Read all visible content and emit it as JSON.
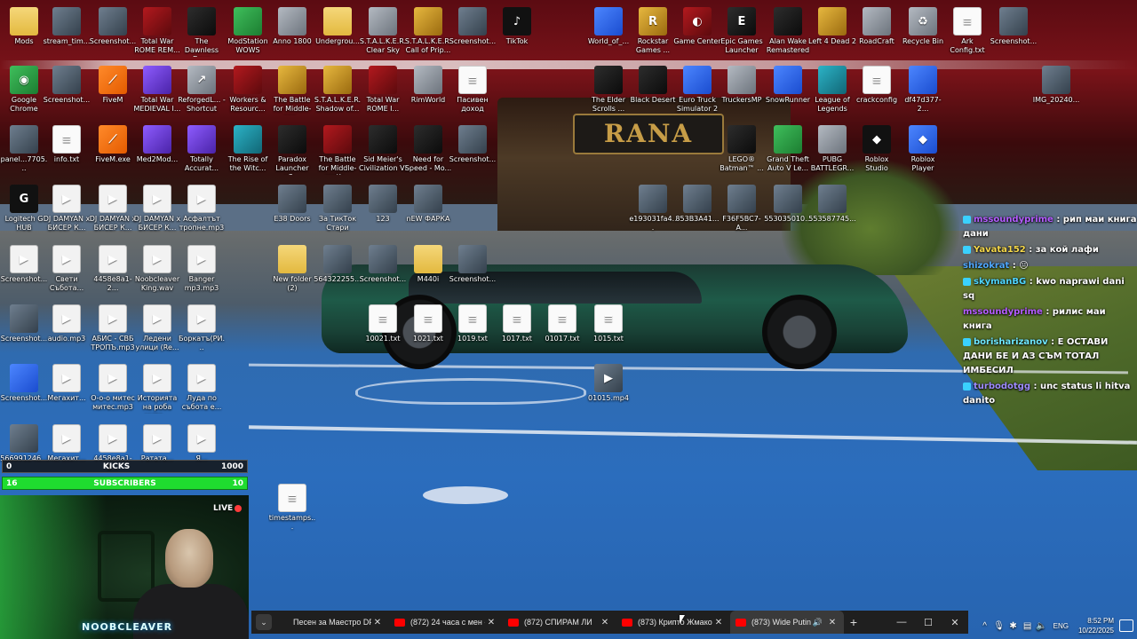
{
  "desktop_icons": [
    {
      "label": "Mods",
      "icon": "folder-icon",
      "kind": "folder"
    },
    {
      "label": "stream_tim...",
      "icon": "image-file-icon",
      "kind": "img"
    },
    {
      "label": "Screenshot...",
      "icon": "image-file-icon",
      "kind": "img"
    },
    {
      "label": "Total War ROME REM...",
      "icon": "game-icon",
      "kind": "red"
    },
    {
      "label": "The Dawnless Days Officia...",
      "icon": "game-icon",
      "kind": "dark"
    },
    {
      "label": "ModStation WOWS",
      "icon": "game-icon",
      "kind": "green"
    },
    {
      "label": "Anno 1800",
      "icon": "game-icon",
      "kind": "gray"
    },
    {
      "label": "Undergrou...",
      "icon": "folder-icon",
      "kind": "folder"
    },
    {
      "label": "S.T.A.L.K.E.R. Clear Sky",
      "icon": "game-icon",
      "kind": "gray"
    },
    {
      "label": "S.T.A.L.K.E.R. Call of Prip...",
      "icon": "game-icon",
      "kind": "gold"
    },
    {
      "label": "Screenshot...",
      "icon": "image-file-icon",
      "kind": "img"
    },
    {
      "label": "TikTok",
      "icon": "tiktok-icon",
      "kind": "black"
    },
    {
      "label": "World_of_...",
      "icon": "game-icon",
      "kind": "blue"
    },
    {
      "label": "Rockstar Games ...",
      "icon": "rockstar-icon",
      "kind": "gold"
    },
    {
      "label": "Game Center",
      "icon": "game-center-icon",
      "kind": "red"
    },
    {
      "label": "Epic Games Launcher",
      "icon": "epic-games-icon",
      "kind": "dark"
    },
    {
      "label": "Alan Wake Remastered",
      "icon": "game-icon",
      "kind": "dark"
    },
    {
      "label": "Left 4 Dead 2",
      "icon": "game-icon",
      "kind": "gold"
    },
    {
      "label": "RoadCraft",
      "icon": "game-icon",
      "kind": "gray"
    },
    {
      "label": "Recycle Bin",
      "icon": "recycle-bin-icon",
      "kind": "gray"
    },
    {
      "label": "Ark Config.txt",
      "icon": "text-file-icon",
      "kind": "doc"
    },
    {
      "label": "Screenshot...",
      "icon": "image-file-icon",
      "kind": "img"
    },
    {
      "label": "Google Chrome",
      "icon": "chrome-icon",
      "kind": "green"
    },
    {
      "label": "Screenshot...",
      "icon": "image-file-icon",
      "kind": "img"
    },
    {
      "label": "FiveM",
      "icon": "fivem-icon",
      "kind": "orange"
    },
    {
      "label": "Total War MEDIEVAL I...",
      "icon": "game-icon",
      "kind": "purple"
    },
    {
      "label": "ReforgedL... - Shortcut",
      "icon": "shortcut-icon",
      "kind": "gray"
    },
    {
      "label": "Workers & Resourc...",
      "icon": "game-icon",
      "kind": "red"
    },
    {
      "label": "The Battle for Middle-ear...",
      "icon": "game-icon",
      "kind": "gold"
    },
    {
      "label": "S.T.A.L.K.E.R. Shadow of...",
      "icon": "game-icon",
      "kind": "gold"
    },
    {
      "label": "Total War ROME I...",
      "icon": "game-icon",
      "kind": "red"
    },
    {
      "label": "RimWorld",
      "icon": "game-icon",
      "kind": "gray"
    },
    {
      "label": "Пасивен доход",
      "icon": "text-file-icon",
      "kind": "doc"
    },
    {
      "label": "The Elder Scrolls ...",
      "icon": "game-icon",
      "kind": "dark"
    },
    {
      "label": "Black Desert",
      "icon": "game-icon",
      "kind": "dark"
    },
    {
      "label": "Euro Truck Simulator 2",
      "icon": "game-icon",
      "kind": "blue"
    },
    {
      "label": "TruckersMP",
      "icon": "game-icon",
      "kind": "gray"
    },
    {
      "label": "SnowRunner",
      "icon": "game-icon",
      "kind": "blue"
    },
    {
      "label": "League of Legends",
      "icon": "game-icon",
      "kind": "teal"
    },
    {
      "label": "crackconfig",
      "icon": "text-file-icon",
      "kind": "doc"
    },
    {
      "label": "df47d377-2...",
      "icon": "image-file-icon",
      "kind": "blue"
    },
    {
      "label": "IMG_20240...",
      "icon": "image-file-icon",
      "kind": "img"
    },
    {
      "label": "panel...7705...",
      "icon": "image-file-icon",
      "kind": "img"
    },
    {
      "label": "info.txt",
      "icon": "text-file-icon",
      "kind": "doc"
    },
    {
      "label": "FiveM.exe",
      "icon": "fivem-icon",
      "kind": "orange"
    },
    {
      "label": "Med2Mod...",
      "icon": "game-icon",
      "kind": "purple"
    },
    {
      "label": "Totally Accurat...",
      "icon": "game-icon",
      "kind": "purple"
    },
    {
      "label": "The Rise of the Witc...",
      "icon": "game-icon",
      "kind": "teal"
    },
    {
      "label": "Paradox Launcher v2...",
      "icon": "game-icon",
      "kind": "dark"
    },
    {
      "label": "The Battle for Middle-earth...",
      "icon": "game-icon",
      "kind": "red"
    },
    {
      "label": "Sid Meier's Civilization VI",
      "icon": "game-icon",
      "kind": "dark"
    },
    {
      "label": "Need for Speed - Mo...",
      "icon": "game-icon",
      "kind": "dark"
    },
    {
      "label": "Screenshot...",
      "icon": "image-file-icon",
      "kind": "img"
    },
    {
      "label": "LEGO® Batman™ ...",
      "icon": "game-icon",
      "kind": "dark"
    },
    {
      "label": "Grand Theft Auto V Le...",
      "icon": "game-icon",
      "kind": "green"
    },
    {
      "label": "PUBG BATTLEGR...",
      "icon": "game-icon",
      "kind": "gray"
    },
    {
      "label": "Roblox Studio",
      "icon": "roblox-icon",
      "kind": "black"
    },
    {
      "label": "Roblox Player",
      "icon": "roblox-icon",
      "kind": "blue"
    },
    {
      "label": "Logitech G HUB",
      "icon": "logitech-icon",
      "kind": "black"
    },
    {
      "label": "DJ DAMYAN x БИСЕР К...",
      "icon": "media-file-icon",
      "kind": "media"
    },
    {
      "label": "DJ DAMYAN x БИСЕР К...",
      "icon": "media-file-icon",
      "kind": "media"
    },
    {
      "label": "DJ DAMYAN x БИСЕР К...",
      "icon": "media-file-icon",
      "kind": "media"
    },
    {
      "label": "Асфалтът тропне.mp3",
      "icon": "media-file-icon",
      "kind": "media"
    },
    {
      "label": "E38 Doors",
      "icon": "image-file-icon",
      "kind": "img"
    },
    {
      "label": "За ТикТок Стари",
      "icon": "folder-icon",
      "kind": "img"
    },
    {
      "label": "123",
      "icon": "image-file-icon",
      "kind": "img"
    },
    {
      "label": "nEW ФАРКА",
      "icon": "image-file-icon",
      "kind": "img"
    },
    {
      "label": "e193031fa4...",
      "icon": "image-file-icon",
      "kind": "img"
    },
    {
      "label": "853B3A41...",
      "icon": "image-file-icon",
      "kind": "img"
    },
    {
      "label": "F36F5BC7-A...",
      "icon": "image-file-icon",
      "kind": "img"
    },
    {
      "label": "553035010...",
      "icon": "image-file-icon",
      "kind": "img"
    },
    {
      "label": "553587745...",
      "icon": "image-file-icon",
      "kind": "img"
    },
    {
      "label": "Screenshot...",
      "icon": "media-file-icon",
      "kind": "media"
    },
    {
      "label": "Свети Събота...",
      "icon": "media-file-icon",
      "kind": "media"
    },
    {
      "label": "4458e8a1-2...",
      "icon": "media-file-icon",
      "kind": "media"
    },
    {
      "label": "Noobcleaver King.wav",
      "icon": "media-file-icon",
      "kind": "media"
    },
    {
      "label": "Banger mp3.mp3",
      "icon": "media-file-icon",
      "kind": "media"
    },
    {
      "label": "New folder (2)",
      "icon": "folder-icon",
      "kind": "folder"
    },
    {
      "label": "564322255...",
      "icon": "image-file-icon",
      "kind": "img"
    },
    {
      "label": "Screenshot...",
      "icon": "image-file-icon",
      "kind": "img"
    },
    {
      "label": "M440i",
      "icon": "folder-icon",
      "kind": "folder"
    },
    {
      "label": "Screenshot...",
      "icon": "image-file-icon",
      "kind": "img"
    },
    {
      "label": "Screenshot...",
      "icon": "image-file-icon",
      "kind": "img"
    },
    {
      "label": "audio.mp3",
      "icon": "media-file-icon",
      "kind": "media"
    },
    {
      "label": "АБИС - СВБ ТРОПЪ.mp3",
      "icon": "media-file-icon",
      "kind": "media"
    },
    {
      "label": "Ледени улици (Re...",
      "icon": "media-file-icon",
      "kind": "media"
    },
    {
      "label": "Боркатъ(РИ...",
      "icon": "media-file-icon",
      "kind": "media"
    },
    {
      "label": "10021.txt",
      "icon": "text-file-icon",
      "kind": "doc"
    },
    {
      "label": "1021.txt",
      "icon": "text-file-icon",
      "kind": "doc"
    },
    {
      "label": "1019.txt",
      "icon": "text-file-icon",
      "kind": "doc"
    },
    {
      "label": "1017.txt",
      "icon": "text-file-icon",
      "kind": "doc"
    },
    {
      "label": "01017.txt",
      "icon": "text-file-icon",
      "kind": "doc"
    },
    {
      "label": "1015.txt",
      "icon": "text-file-icon",
      "kind": "doc"
    },
    {
      "label": "Screenshot...",
      "icon": "image-file-icon",
      "kind": "blue"
    },
    {
      "label": "Мегахит...",
      "icon": "media-file-icon",
      "kind": "media"
    },
    {
      "label": "О-о-о митес митес.mp3",
      "icon": "media-file-icon",
      "kind": "media"
    },
    {
      "label": "Историята на роба мита...",
      "icon": "media-file-icon",
      "kind": "media"
    },
    {
      "label": "Луда по събота е...",
      "icon": "media-file-icon",
      "kind": "media"
    },
    {
      "label": "01015.mp4",
      "icon": "video-file-icon",
      "kind": "img"
    },
    {
      "label": "566991246...",
      "icon": "image-file-icon",
      "kind": "img"
    },
    {
      "label": "Мегахит...",
      "icon": "media-file-icon",
      "kind": "media"
    },
    {
      "label": "4458e8a1-2...",
      "icon": "media-file-icon",
      "kind": "media"
    },
    {
      "label": "Ратата...",
      "icon": "media-file-icon",
      "kind": "media"
    },
    {
      "label": "Я...",
      "icon": "media-file-icon",
      "kind": "media"
    },
    {
      "label": "timestamps...",
      "icon": "text-file-icon",
      "kind": "doc"
    }
  ],
  "chat": [
    {
      "user": "mssoundyprime",
      "text": ": рип маи книга дани",
      "color": "#b45cff",
      "badge": "#3ad1ff"
    },
    {
      "user": "Yavata152",
      "text": ": за кой лафи",
      "color": "#f5d84a",
      "badge": "#3ad1ff"
    },
    {
      "user": "shizokrat",
      "text": ": 😐",
      "color": "#4fa8ff",
      "badge": ""
    },
    {
      "user": "skymanBG",
      "text": ": kwo naprawi dani sq",
      "color": "#4fd6ff",
      "badge": "#3ad1ff"
    },
    {
      "user": "mssoundyprime",
      "text": ": рилис маи книга",
      "color": "#b45cff",
      "badge": ""
    },
    {
      "user": "borisharizanov",
      "text": ": Е ОСТАВИ ДАНИ БЕ И АЗ СЪМ ТОТАЛ ИМБЕСИЛ",
      "color": "#6ee7ff",
      "badge": "#3ad1ff"
    },
    {
      "user": "turbodotgg",
      "text": ": unc status li hitva danito",
      "color": "#9e8cff",
      "badge": "#3ad1ff"
    }
  ],
  "widgets": {
    "kicks": {
      "left": "0",
      "label": "KICKS",
      "right": "1000"
    },
    "subscribers": {
      "left": "16",
      "label": "SUBSCRIBERS",
      "right": "10"
    },
    "webcam": {
      "live": "LIVE",
      "name": "NOOBCLEAVER"
    }
  },
  "browser_tabs": {
    "tabs": [
      {
        "title": "Песен за Маестро DP",
        "icon": "none",
        "active": false,
        "audio": false
      },
      {
        "title": "(872) 24 часа с мен - ",
        "icon": "youtube-icon",
        "active": false,
        "audio": false
      },
      {
        "title": "(872) СПИРАМ ЛИ",
        "icon": "youtube-icon",
        "active": false,
        "audio": false
      },
      {
        "title": "(873) Крипто Жмакове",
        "icon": "youtube-icon",
        "active": false,
        "audio": false
      },
      {
        "title": "(873) Wide Putin",
        "icon": "youtube-icon",
        "active": true,
        "audio": true
      }
    ],
    "new_tab": "+",
    "dropdown": "⌄",
    "minimize": "—",
    "maximize": "☐",
    "close": "✕"
  },
  "tray": {
    "chevron": "^",
    "language": "ENG",
    "time": "8:52 PM",
    "date": "10/22/2025"
  },
  "wallpaper_sign": "RANA"
}
